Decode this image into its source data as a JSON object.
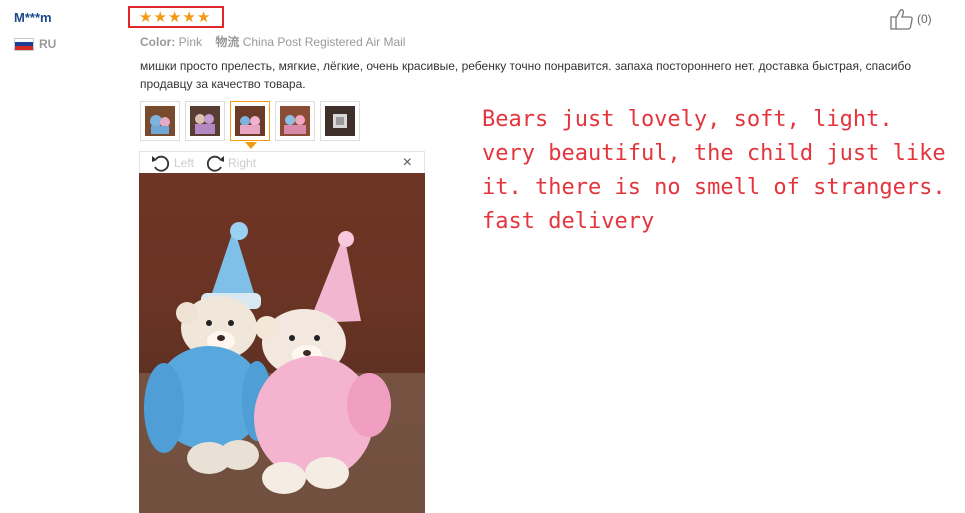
{
  "reviewer": {
    "name": "M***m",
    "country_code": "RU",
    "flag_colors": [
      "#ffffff",
      "#1c3f9a",
      "#d52b1e"
    ]
  },
  "rating": {
    "stars": 5,
    "max": 5,
    "star_glyph": "★",
    "color": "#f29a12",
    "highlight_color": "#e0262b"
  },
  "attributes": {
    "color_label": "Color:",
    "color_value": "Pink",
    "shipping_label": "物流",
    "shipping_value": "China Post Registered Air Mail"
  },
  "review_text": "мишки просто прелесть, мягкие, лёгкие, очень красивые, ребенку точно понравится. запаха постороннего нет. доставка быстрая, спасибо продавцу за качество товара.",
  "helpful": {
    "icon": "thumbs-up-icon",
    "count_text": "(0)"
  },
  "thumbnails": [
    {
      "name": "photo-1",
      "active": false
    },
    {
      "name": "photo-2",
      "active": false
    },
    {
      "name": "photo-3",
      "active": true
    },
    {
      "name": "photo-4",
      "active": false
    },
    {
      "name": "photo-5",
      "active": false
    }
  ],
  "viewer": {
    "rotate_left_label": "Left",
    "rotate_right_label": "Right",
    "close_glyph": "×"
  },
  "translation": {
    "lines": [
      "Bears just lovely, soft, light.",
      "very beautiful, the child just like",
      "it. there is no smell of strangers.",
      "fast delivery"
    ],
    "color": "#e4353d"
  }
}
